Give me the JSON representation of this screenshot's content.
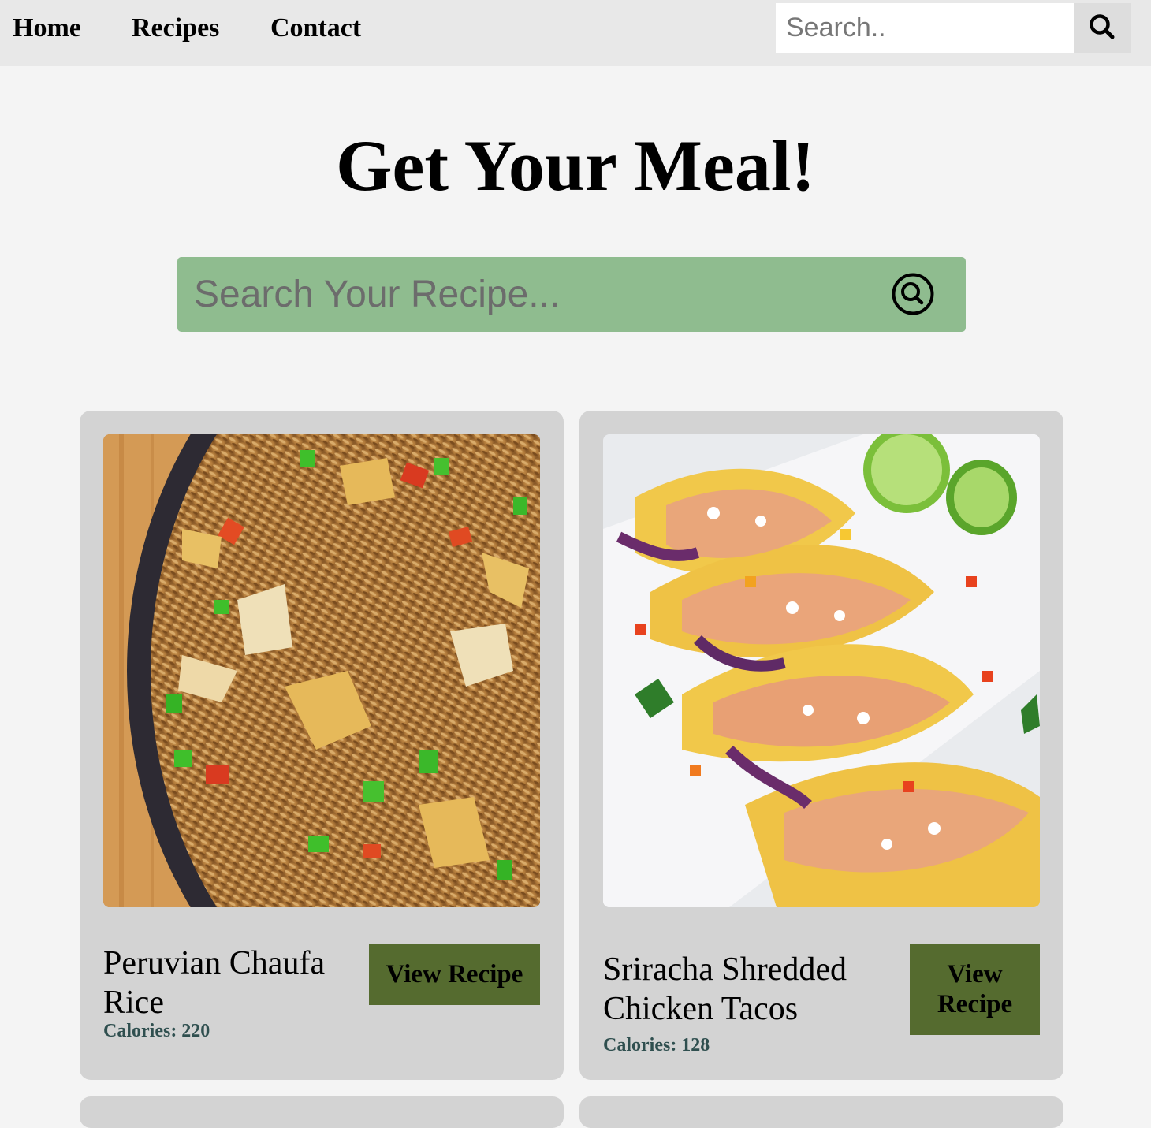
{
  "nav": {
    "links": [
      "Home",
      "Recipes",
      "Contact"
    ],
    "search_placeholder": "Search.."
  },
  "hero": {
    "title": "Get Your Meal!",
    "search_placeholder": "Search Your Recipe..."
  },
  "recipes": [
    {
      "title": "Peruvian Chaufa Rice",
      "calories": "Calories: 220",
      "button": "View Recipe",
      "image": "fried-rice-photo"
    },
    {
      "title": "Sriracha Shredded Chicken Tacos",
      "calories": "Calories: 128",
      "button": "View Recipe",
      "image": "chicken-tacos-photo"
    }
  ],
  "colors": {
    "nav_bg": "#e8e8e8",
    "page_bg": "#f4f4f4",
    "hero_search_bg": "#8fbc8f",
    "card_bg": "#d3d3d3",
    "button_bg": "#556b2f",
    "calories_text": "#2f4f4f"
  }
}
